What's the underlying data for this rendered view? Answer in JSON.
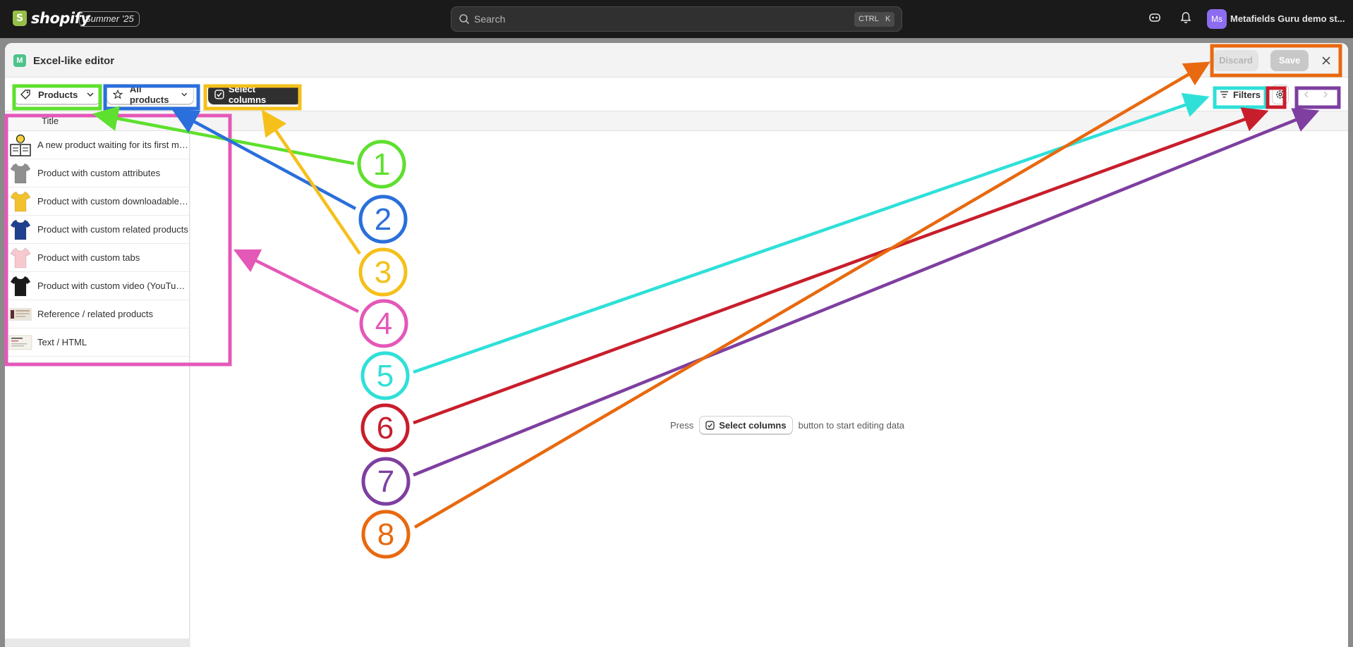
{
  "topbar": {
    "brand": "shopify",
    "edition": "Summer '25",
    "search_placeholder": "Search",
    "shortcut_ctrl": "CTRL",
    "shortcut_key": "K",
    "avatar_initials": "Ms",
    "store_name": "Metafields Guru demo st..."
  },
  "modal": {
    "title": "Excel-like editor",
    "discard_label": "Discard",
    "save_label": "Save"
  },
  "toolbar": {
    "resource_label": "Products",
    "view_label": "All products",
    "select_columns_label": "Select columns",
    "filters_label": "Filters"
  },
  "table": {
    "column_title": "Title",
    "rows": [
      {
        "title": "A new product waiting for its first metaf...",
        "thumb": "book-lightbulb-icon"
      },
      {
        "title": "Product with custom attributes",
        "thumb": "gray-tshirt-icon"
      },
      {
        "title": "Product with custom downloadable (PD...",
        "thumb": "yellow-tshirt-icon"
      },
      {
        "title": "Product with custom related products",
        "thumb": "blue-tshirt-icon"
      },
      {
        "title": "Product with custom tabs",
        "thumb": "pink-tshirt-icon"
      },
      {
        "title": "Product with custom video (YouTube)",
        "thumb": "black-tshirt-icon"
      },
      {
        "title": "Reference / related products",
        "thumb": "reference-thumbnail"
      },
      {
        "title": "Text / HTML",
        "thumb": "text-thumbnail"
      }
    ]
  },
  "empty_state": {
    "prefix": "Press",
    "button_label": "Select columns",
    "suffix": "button to start editing data"
  },
  "annotations": [
    {
      "number": "1",
      "color": "#5ee02e"
    },
    {
      "number": "2",
      "color": "#2a6fdb"
    },
    {
      "number": "3",
      "color": "#f5c01a"
    },
    {
      "number": "4",
      "color": "#e458b8"
    },
    {
      "number": "5",
      "color": "#2fe0d8"
    },
    {
      "number": "6",
      "color": "#c81e2c"
    },
    {
      "number": "7",
      "color": "#7e3fa0"
    },
    {
      "number": "8",
      "color": "#e8690f"
    }
  ]
}
